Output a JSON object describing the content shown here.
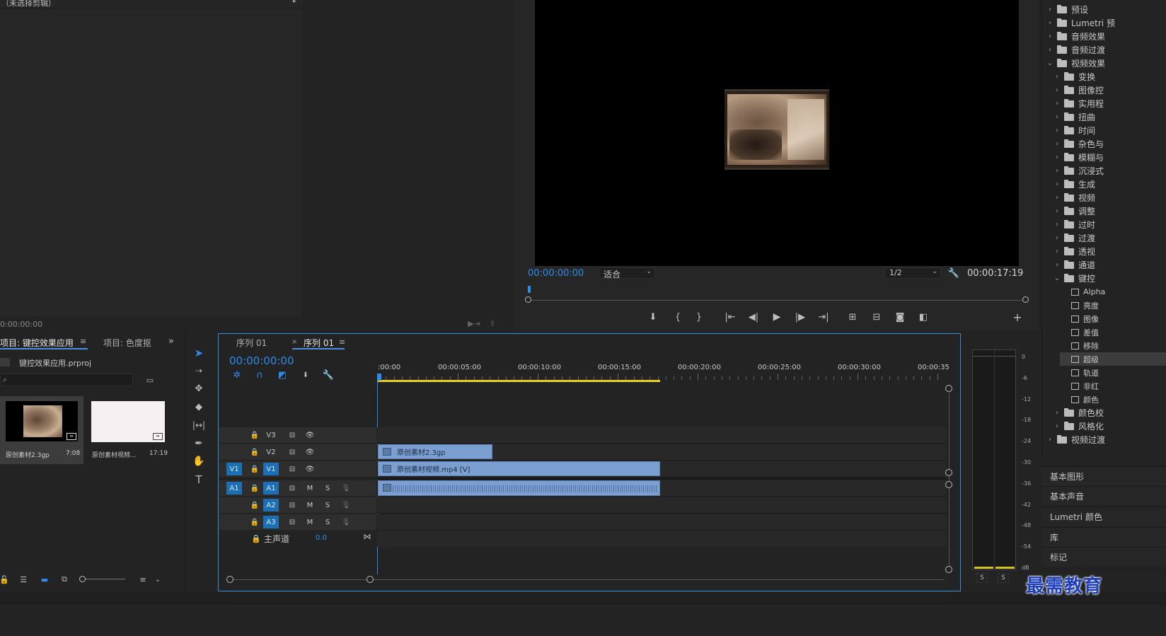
{
  "source_panel": {
    "header": "（未选择剪辑）",
    "timecode": "0:00:00:00"
  },
  "program_monitor": {
    "timecode_current": "00:00:00:00",
    "fit": "适合",
    "resolution": "1/2",
    "timecode_total": "00:00:17:19"
  },
  "effects_panel": {
    "items": [
      {
        "label": "预设",
        "level": 0,
        "type": "folder",
        "expanded": false
      },
      {
        "label": "Lumetri 预",
        "level": 0,
        "type": "folder",
        "expanded": false
      },
      {
        "label": "音频效果",
        "level": 0,
        "type": "folder",
        "expanded": false
      },
      {
        "label": "音频过渡",
        "level": 0,
        "type": "folder",
        "expanded": false
      },
      {
        "label": "视频效果",
        "level": 0,
        "type": "folder",
        "expanded": true
      },
      {
        "label": "变换",
        "level": 1,
        "type": "folder",
        "expanded": false
      },
      {
        "label": "图像控",
        "level": 1,
        "type": "folder",
        "expanded": false
      },
      {
        "label": "实用程",
        "level": 1,
        "type": "folder",
        "expanded": false
      },
      {
        "label": "扭曲",
        "level": 1,
        "type": "folder",
        "expanded": false
      },
      {
        "label": "时间",
        "level": 1,
        "type": "folder",
        "expanded": false
      },
      {
        "label": "杂色与",
        "level": 1,
        "type": "folder",
        "expanded": false
      },
      {
        "label": "模糊与",
        "level": 1,
        "type": "folder",
        "expanded": false
      },
      {
        "label": "沉浸式",
        "level": 1,
        "type": "folder",
        "expanded": false
      },
      {
        "label": "生成",
        "level": 1,
        "type": "folder",
        "expanded": false
      },
      {
        "label": "视频",
        "level": 1,
        "type": "folder",
        "expanded": false
      },
      {
        "label": "调整",
        "level": 1,
        "type": "folder",
        "expanded": false
      },
      {
        "label": "过时",
        "level": 1,
        "type": "folder",
        "expanded": false
      },
      {
        "label": "过渡",
        "level": 1,
        "type": "folder",
        "expanded": false
      },
      {
        "label": "透视",
        "level": 1,
        "type": "folder",
        "expanded": false
      },
      {
        "label": "通道",
        "level": 1,
        "type": "folder",
        "expanded": false
      },
      {
        "label": "键控",
        "level": 1,
        "type": "folder",
        "expanded": true
      },
      {
        "label": "Alpha",
        "level": 2,
        "type": "effect",
        "expanded": false
      },
      {
        "label": "亮度",
        "level": 2,
        "type": "effect",
        "expanded": false
      },
      {
        "label": "图像",
        "level": 2,
        "type": "effect",
        "expanded": false
      },
      {
        "label": "差值",
        "level": 2,
        "type": "effect",
        "expanded": false
      },
      {
        "label": "移除",
        "level": 2,
        "type": "effect",
        "expanded": false
      },
      {
        "label": "超级",
        "level": 2,
        "type": "effect",
        "expanded": false,
        "selected": true
      },
      {
        "label": "轨道",
        "level": 2,
        "type": "effect",
        "expanded": false
      },
      {
        "label": "非红",
        "level": 2,
        "type": "effect",
        "expanded": false
      },
      {
        "label": "颜色",
        "level": 2,
        "type": "effect",
        "expanded": false
      },
      {
        "label": "颜色校",
        "level": 1,
        "type": "folder",
        "expanded": false
      },
      {
        "label": "风格化",
        "level": 1,
        "type": "folder",
        "expanded": false
      },
      {
        "label": "视频过渡",
        "level": 0,
        "type": "folder",
        "expanded": false
      }
    ],
    "tabs": [
      "基本图形",
      "基本声音",
      "Lumetri 颜色",
      "库",
      "标记"
    ]
  },
  "project_panel": {
    "tab_active": "项目: 键控效果应用",
    "tab_other": "项目: 色度抠",
    "file_name": "键控效果应用.prproj",
    "clips": [
      {
        "name": "原创素材2.3gp",
        "duration": "7:08"
      },
      {
        "name": "原创素材视频...",
        "duration": "17:19"
      }
    ]
  },
  "timeline": {
    "tab_1": "序列 01",
    "tab_2": "序列 01",
    "timecode": "00:00:00:00",
    "ruler": [
      ":00:00",
      "00:00:05:00",
      "00:00:10:00",
      "00:00:15:00",
      "00:00:20:00",
      "00:00:25:00",
      "00:00:30:00",
      "00:00:35"
    ],
    "video_tracks": [
      {
        "id": "V3",
        "source": ""
      },
      {
        "id": "V2",
        "source": ""
      },
      {
        "id": "V1",
        "source": "V1"
      }
    ],
    "audio_tracks": [
      {
        "id": "A1",
        "source": "A1"
      },
      {
        "id": "A2",
        "source": ""
      },
      {
        "id": "A3",
        "source": ""
      }
    ],
    "mute_label": "M",
    "solo_label": "S",
    "master_label": "主声道",
    "master_value": "0.0",
    "clips": {
      "v2": "原创素材2.3gp",
      "v1": "原创素材视频.mp4 [V]"
    }
  },
  "meters": {
    "db_labels": [
      "0",
      "-6",
      "-12",
      "-18",
      "-24",
      "-30",
      "-36",
      "-42",
      "-48",
      "-54",
      "dB"
    ],
    "solo_left": "S",
    "solo_right": "S"
  },
  "watermark": "最需教育"
}
